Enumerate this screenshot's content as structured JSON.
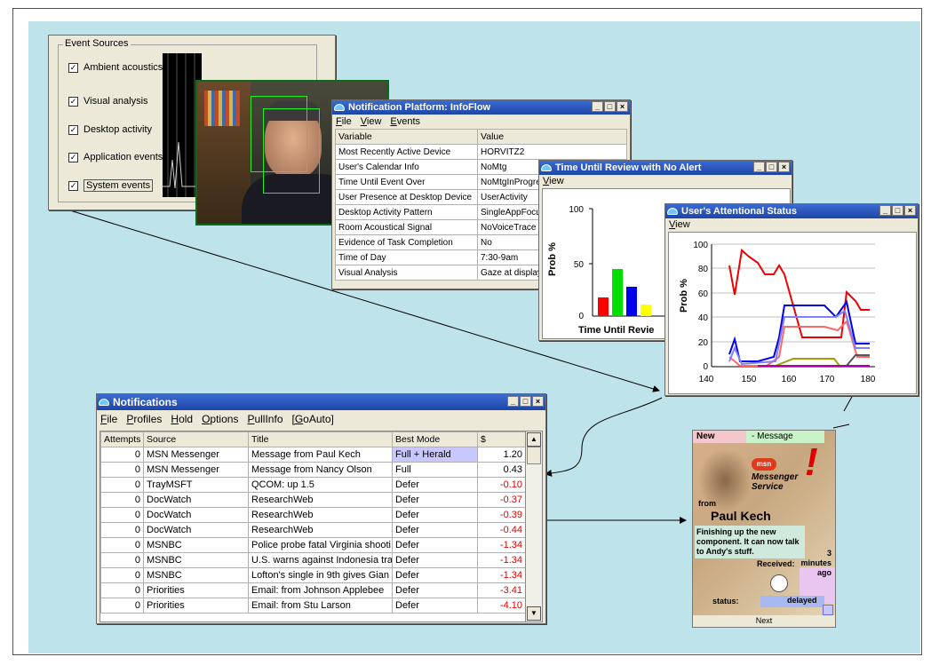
{
  "event_sources": {
    "group_label": "Event Sources",
    "items": [
      "Ambient acoustics",
      "Visual analysis",
      "Desktop activity",
      "Application events",
      "System events"
    ]
  },
  "infoflow": {
    "title": "Notification Platform: InfoFlow",
    "menu": [
      "File",
      "View",
      "Events"
    ],
    "headers": [
      "Variable",
      "Value"
    ],
    "rows": [
      [
        "Most Recently Active Device",
        "HORVITZ2"
      ],
      [
        "User's Calendar Info",
        "NoMtg"
      ],
      [
        "Time Until Event Over",
        "NoMtgInProgre"
      ],
      [
        "User Presence at Desktop Device",
        "UserActivity"
      ],
      [
        "Desktop Activity Pattern",
        "SingleAppFocu"
      ],
      [
        "Room Acoustical Signal",
        "NoVoiceTrace"
      ],
      [
        "Evidence of Task Completion",
        "No"
      ],
      [
        "Time of Day",
        "7:30-9am"
      ],
      [
        "Visual Analysis",
        "Gaze at display"
      ]
    ]
  },
  "review_window": {
    "title": "Time Until Review with No Alert",
    "menu": [
      "View"
    ],
    "ylabel": "Prob %",
    "xlabel": "Time Until Revie",
    "yticks": [
      "100",
      "50",
      "0"
    ]
  },
  "attention_window": {
    "title": "User's Attentional Status",
    "menu": [
      "View"
    ],
    "ylabel": "Prob %",
    "yticks": [
      "100",
      "80",
      "60",
      "40",
      "20",
      "0"
    ],
    "xticks": [
      "140",
      "150",
      "160",
      "170",
      "180"
    ]
  },
  "notifications": {
    "title": "Notifications",
    "menu": [
      "File",
      "Profiles",
      "Hold",
      "Options",
      "PullInfo",
      "[GoAuto]"
    ],
    "headers": [
      "Attempts",
      "Source",
      "Title",
      "Best Mode",
      "$"
    ],
    "rows": [
      [
        "0",
        "MSN Messenger",
        "Message from Paul Kech",
        "Full + Herald",
        "1.20"
      ],
      [
        "0",
        "MSN Messenger",
        "Message from Nancy Olson",
        "Full",
        "0.43"
      ],
      [
        "0",
        "TrayMSFT",
        "QCOM: up 1.5",
        "Defer",
        "-0.10"
      ],
      [
        "0",
        "DocWatch",
        "ResearchWeb",
        "Defer",
        "-0.37"
      ],
      [
        "0",
        "DocWatch",
        "ResearchWeb",
        "Defer",
        "-0.39"
      ],
      [
        "0",
        "DocWatch",
        "ResearchWeb",
        "Defer",
        "-0.44"
      ],
      [
        "0",
        "MSNBC",
        "Police probe fatal Virginia shooti",
        "Defer",
        "-1.34"
      ],
      [
        "0",
        "MSNBC",
        "U.S. warns against Indonesia tra",
        "Defer",
        "-1.34"
      ],
      [
        "0",
        "MSNBC",
        "Lofton's single in 9th gives Gian",
        "Defer",
        "-1.34"
      ],
      [
        "0",
        "Priorities",
        "Email: from Johnson Applebee",
        "Defer",
        "-3.41"
      ],
      [
        "0",
        "Priorities",
        "Email: from Stu Larson",
        "Defer",
        "-4.10"
      ]
    ]
  },
  "messenger": {
    "new_label": "New",
    "message_label": "- Message",
    "brand": "Messenger Service",
    "logo_text": "msn",
    "from_label": "from",
    "sender": "Paul Kech",
    "body": "Finishing up the new component.  It can now talk to Andy's stuff.",
    "received_label": "Received:",
    "received_value": "3 minutes ago",
    "status_label": "status:",
    "status_value": "delayed",
    "next_label": "Next"
  },
  "colors": {
    "canvas": "#bfe3ea",
    "title_blue": "#2352b8",
    "negative": "#e10000",
    "highlight": "#c8c8ff"
  }
}
